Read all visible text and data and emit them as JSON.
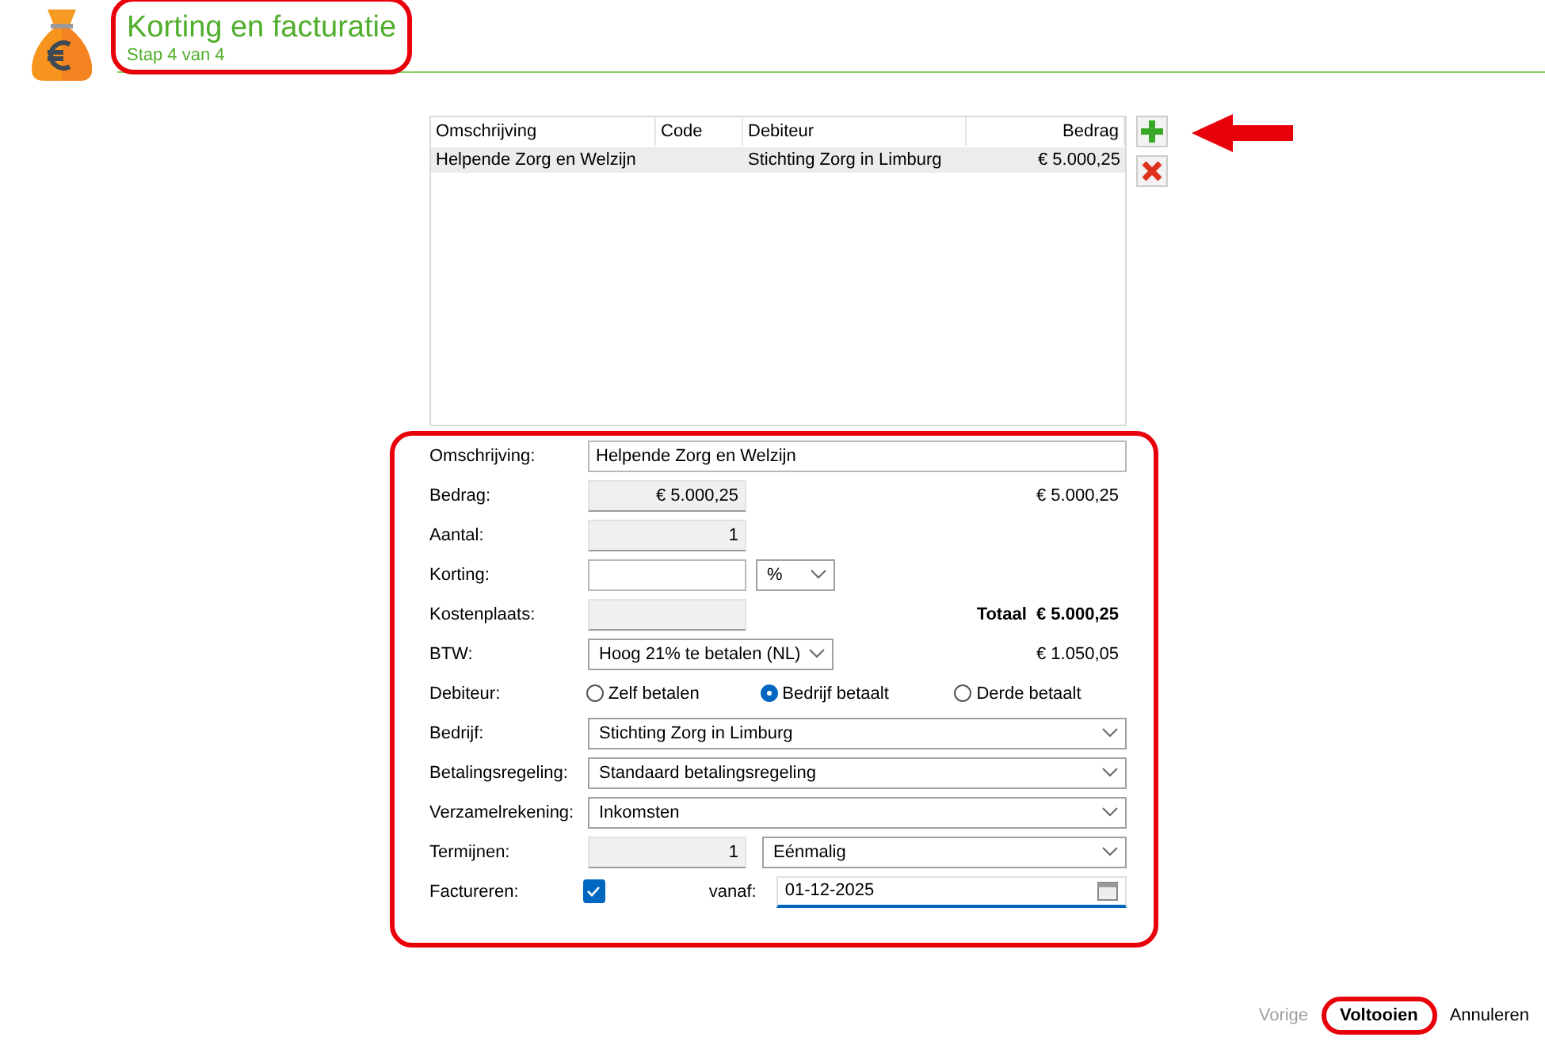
{
  "header": {
    "title": "Korting en facturatie",
    "subtitle": "Stap 4 van 4",
    "highlighted": true
  },
  "table": {
    "columns": [
      "Omschrijving",
      "Code",
      "Debiteur",
      "Bedrag"
    ],
    "rows": [
      {
        "omschrijving": "Helpende Zorg en Welzijn",
        "debiteur": "Stichting Zorg in Limburg",
        "bedrag": "€ 5.000,25",
        "selected": true
      }
    ]
  },
  "table_actions": [
    {
      "kind": "add",
      "pointed_at": true
    },
    {
      "kind": "delete",
      "pointed_at": false
    }
  ],
  "form": {
    "highlighted": true,
    "rows": [
      {
        "kind": "text",
        "label": "Omschrijving:",
        "value": "Helpende Zorg en Welzijn"
      },
      {
        "kind": "field",
        "label": "Bedrag:",
        "value": "€ 5.000,25",
        "readonly": true,
        "aside": "€ 5.000,25"
      },
      {
        "kind": "field",
        "label": "Aantal:",
        "value": "1",
        "readonly": true
      },
      {
        "kind": "field",
        "label": "Korting:",
        "readonly": false,
        "unit": "%"
      },
      {
        "kind": "field",
        "label": "Kostenplaats:",
        "readonly": true,
        "total": {
          "label": "Totaal",
          "value": "€ 5.000,25"
        }
      },
      {
        "kind": "short-select",
        "label": "BTW:",
        "value": "Hoog 21% te betalen (NL)",
        "aside": "€ 1.050,05"
      },
      {
        "kind": "radio",
        "label": "Debiteur:",
        "options": [
          {
            "label": "Zelf betalen",
            "selected": false
          },
          {
            "label": "Bedrijf betaalt",
            "selected": true
          },
          {
            "label": "Derde betaalt",
            "selected": false
          }
        ]
      },
      {
        "kind": "select",
        "label": "Bedrijf:",
        "value": "Stichting Zorg in Limburg"
      },
      {
        "kind": "select",
        "label": "Betalingsregeling:",
        "value": "Standaard betalingsregeling"
      },
      {
        "kind": "select",
        "label": "Verzamelrekening:",
        "value": "Inkomsten"
      },
      {
        "kind": "field",
        "label": "Termijnen:",
        "value": "1",
        "readonly": true,
        "select": "Eénmalig"
      },
      {
        "kind": "invoice",
        "label": "Factureren:",
        "checked": true,
        "from_label": "vanaf:",
        "date": "01-12-2025",
        "focused": true
      }
    ]
  },
  "footer": [
    {
      "label": "Vorige",
      "disabled": true,
      "default": false,
      "highlighted": false
    },
    {
      "label": "Voltooien",
      "disabled": false,
      "default": true,
      "highlighted": true
    },
    {
      "label": "Annuleren",
      "disabled": false,
      "default": false,
      "highlighted": false
    }
  ]
}
